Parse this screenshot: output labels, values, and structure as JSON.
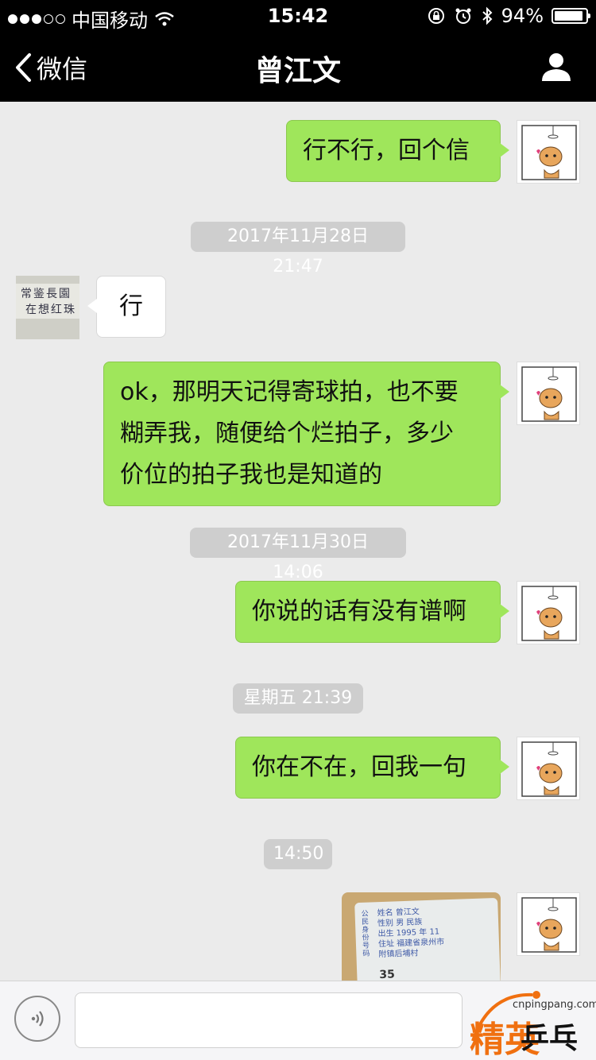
{
  "status_bar": {
    "carrier": "中国移动",
    "time": "15:42",
    "battery": "94%",
    "battery_level": 0.94
  },
  "nav": {
    "back_label": "微信",
    "title": "曾江文"
  },
  "messages": {
    "m1": "行不行，回个信",
    "ts1": "2017年11月28日 21:47",
    "m2": "行",
    "m3_line1": "ok，那明天记得寄球拍，也不要",
    "m3_line2": "糊弄我，随便给个烂拍子，多少",
    "m3_line3": "价位的拍子我也是知道的",
    "ts2": "2017年11月30日 14:06",
    "m4": "你说的话有没有谱啊",
    "ts3": "星期五 21:39",
    "m5": "你在不在，回我一句",
    "ts4": "14:50"
  },
  "contact_avatar": {
    "line1": "常鉴長園",
    "line2": "在想红珠"
  },
  "photo_card": {
    "row1": "姓名  曾江文",
    "row2": "性别  男   民族",
    "row3": "出生  1995 年 11",
    "row4": "住址  福建省泉州市",
    "row5": "附镇后埔村",
    "side": "公民身份号码",
    "num": "35"
  },
  "watermark": {
    "url": "cnpingpang.com",
    "brand_a": "精英",
    "brand_b": "乒乓网"
  },
  "colors": {
    "bubble_green": "#9fe65b",
    "nav_bg": "#000000",
    "chat_bg": "#ebebeb"
  }
}
